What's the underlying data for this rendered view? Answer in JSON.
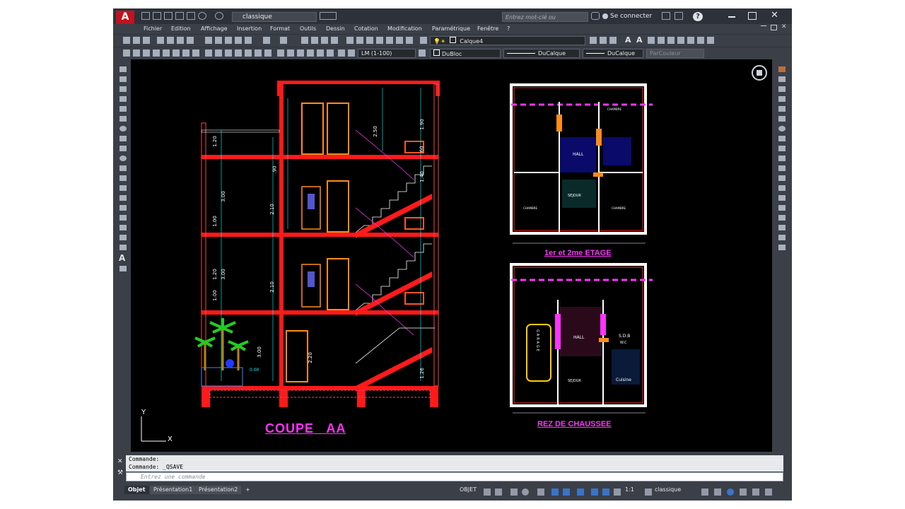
{
  "window": {
    "workspace_name": "classique",
    "search_placeholder": "Entrez mot-clé ou expression",
    "signin_label": "Se connecter",
    "help_label": "?"
  },
  "menubar": {
    "items": [
      "Fichier",
      "Edition",
      "Affichage",
      "Insertion",
      "Format",
      "Outils",
      "Dessin",
      "Cotation",
      "Modification",
      "Paramétrique",
      "Fenêtre",
      "?"
    ]
  },
  "toolbar1": {
    "layer_combo": "Calque4"
  },
  "toolbar2": {
    "scale_combo": "LM (1-100)",
    "color_combo": "DuBloc",
    "linetype_combo": "DuCalque",
    "lineweight_combo": "DuCalque",
    "plotstyle_combo": "ParCouleur"
  },
  "drawing": {
    "section_title": "COUPE   AA",
    "plan_upper_title": "1er et 2me ETAGE",
    "plan_ground_title": "REZ DE CHAUSSEE",
    "room_labels": {
      "hall": "HALL",
      "chambre": "CHAMBRE",
      "sejour": "SEJOUR",
      "sdb": "S.D.B",
      "wc": "W.C",
      "cuisine": "Cuisine",
      "garage": "GARAGE"
    },
    "dims_section": [
      "1.20",
      "3.00",
      "1.00",
      "1.20",
      "3.00",
      "1.00",
      "3.00",
      "2.10",
      "2.10",
      "2.20",
      "2.50",
      "1.90",
      "1.40",
      ".90",
      ".60",
      "1.26",
      "0.00"
    ]
  },
  "ucs": {
    "y_label": "Y",
    "x_label": "X"
  },
  "command": {
    "history": [
      "Commande:",
      "Commande:  _QSAVE"
    ],
    "placeholder": "Entrez une commande"
  },
  "statusbar": {
    "tabs": [
      "Objet",
      "Présentation1",
      "Présentation2",
      "+"
    ],
    "mode_label": "OBJET",
    "scale_label": "1:1",
    "workspace_label": "classique"
  }
}
